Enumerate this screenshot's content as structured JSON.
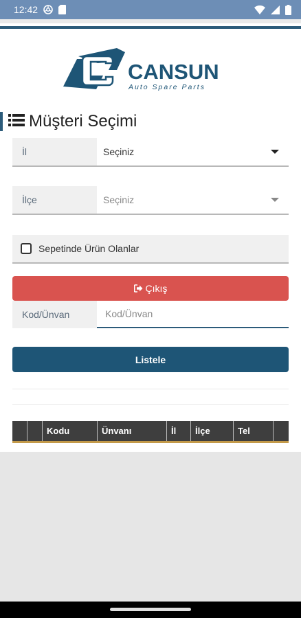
{
  "status_bar": {
    "time": "12:42"
  },
  "brand": {
    "name": "CANSUN",
    "tagline": "Auto Spare Parts"
  },
  "section": {
    "title": "Müşteri Seçimi"
  },
  "form": {
    "il": {
      "label": "İl",
      "value": "Seçiniz"
    },
    "ilce": {
      "label": "İlçe",
      "value": "Seçiniz"
    },
    "checkbox": {
      "label": "Sepetinde Ürün Olanlar",
      "checked": false
    },
    "exit_label": "Çıkış",
    "kod": {
      "label": "Kod/Ünvan",
      "placeholder": "Kod/Ünvan"
    },
    "list_label": "Listele"
  },
  "table": {
    "headers": [
      "",
      "",
      "Kodu",
      "Ünvanı",
      "İl",
      "İlçe",
      "Tel",
      ""
    ]
  },
  "colors": {
    "status_bar": "#6d8eb6",
    "primary": "#1e5576",
    "danger": "#d9534f",
    "table_header": "#3e3e3e",
    "table_accent": "#c39a4a"
  }
}
